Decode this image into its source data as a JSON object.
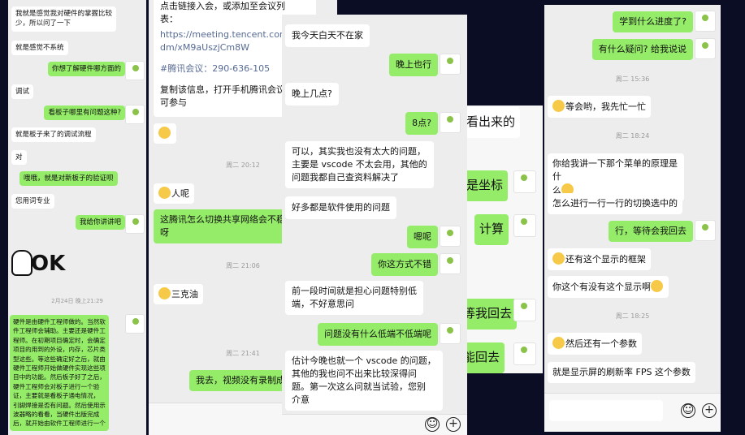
{
  "p1": {
    "m1": "我就是感觉我对硬件的掌握比较\n少，所以问了一下",
    "m2": "就是感觉不系统",
    "m3": "你想了解硬件哪方面的",
    "m4": "调试",
    "m5": "看板子哪里有问题这种?",
    "m6": "就是板子来了的调试流程",
    "m7": "对",
    "m8": "哦哦，就是对新板子的验证呗",
    "m9": "您用词专业",
    "m10": "我给你讲讲吧",
    "ok_text": "OK",
    "time": "2月24日 晚上21:29",
    "long": "硬件是由硬件工程师做的。当然软\n件工程师会辅助。主要还是硬件工\n程师。在初期项目确定时，会确定\n项目的用到的外设，内存，芯片类\n型这些。等这些确定好之后，就由\n硬件工程师开始做硬件实现这些项\n目中的功能。然后板子好了之后，\n硬件工程师会对板子进行一个验\n证，主要就是看板子通电情况，\n引脚焊接是否有问题。然后使用示\n波器略的看看，当硬件出版完成\n后，就开始由软件工程师进行一个"
  },
  "p2": {
    "top": "点击链接入会，或添加至会议列\n表：",
    "link": "https://meeting.tencent.com/\ndm/xM9aUszjCm8W",
    "meeting": "#腾讯会议：290-636-105",
    "copy": "复制该信息，打开手机腾讯会议即\n可参与",
    "t1": "周二 20:12",
    "m_renne": "人呢",
    "m_switch": "这腾讯怎么切换共享网络会不稳\n呀",
    "t2": "周二 21:06",
    "m_sanke": "三克油",
    "t3": "周二 21:41",
    "m_record": "我去，视频没有录制成"
  },
  "p3": {
    "m1": "我今天白天不在家",
    "m2": "晚上也行",
    "m3": "晚上几点?",
    "m4": "8点?",
    "m5": "可以，其实我也没有太大的问题，\n主要是 vscode 不太会用，其他的\n问题我都自己查资料解决了",
    "m6": "好多都是软件使用的问题",
    "m7": "嗯呢",
    "m8": "你这方式不错",
    "m9": "前一段时间就是担心问题特别低\n端，不好意思问",
    "m10": "问题没有什么低端不低端呢",
    "m11": "估计今晚也就一个 vscode 的问题，\n其他的我也问不出来比较深得问\n题。第一次这么问就当试验，您别\n介意"
  },
  "p4": {
    "m1": "看出来的",
    "m2": "是坐标",
    "m3": "计算",
    "m4": "等我回去",
    "m5": "能回去"
  },
  "p5": {
    "m1": "学到什么进度了?",
    "m2": "有什么疑问? 给我说说",
    "t1": "周二 15:36",
    "m3": "等会哟，我先忙一忙",
    "t2": "周二 18:24",
    "m4a": "你给我讲一下那个菜单的原理是什",
    "m4b": "么",
    "m5": "怎么进行一行一行的切换选中的",
    "m6": "行，等待会我回去",
    "m7": "还有这个显示的框架",
    "m8": "你这个有没有这个显示啊",
    "t3": "周二 18:25",
    "m9": "然后还有一个参数",
    "m10": "就是显示屏的刷新率 FPS 这个参数"
  }
}
